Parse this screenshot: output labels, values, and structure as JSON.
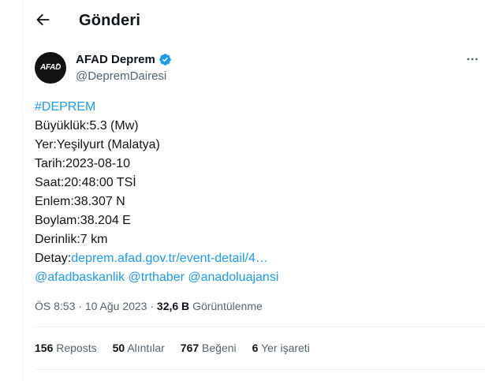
{
  "header": {
    "title": "Gönderi"
  },
  "author": {
    "avatar_text": "AFAD",
    "name": "AFAD Deprem",
    "handle": "@DepremDairesi"
  },
  "tweet": {
    "hashtag": "#DEPREM",
    "lines": [
      "Büyüklük:5.3 (Mw)",
      "Yer:Yeşilyurt (Malatya)",
      "Tarih:2023-08-10",
      "Saat:20:48:00 TSİ",
      "Enlem:38.307 N",
      "Boylam:38.204 E",
      "Derinlik:7 km"
    ],
    "detail_label": "Detay:",
    "detail_link": "deprem.afad.gov.tr/event-detail/4…",
    "mentions": [
      "@afadbaskanlik",
      "@trthaber",
      "@anadoluajansi"
    ]
  },
  "meta": {
    "time": "ÖS 8:53",
    "date": "10 Ağu 2023",
    "views_count": "32,6 B",
    "views_label": "Görüntülenme"
  },
  "stats": [
    {
      "count": "156",
      "label": "Reposts"
    },
    {
      "count": "50",
      "label": "Alıntılar"
    },
    {
      "count": "767",
      "label": "Beğeni"
    },
    {
      "count": "6",
      "label": "Yer işareti"
    }
  ],
  "colors": {
    "link": "#1d9bf0",
    "verified": "#1d9bf0",
    "muted": "#536471"
  },
  "icons": {
    "back": "arrow-left-icon",
    "verified": "verified-badge-icon",
    "more": "more-dots-icon"
  }
}
